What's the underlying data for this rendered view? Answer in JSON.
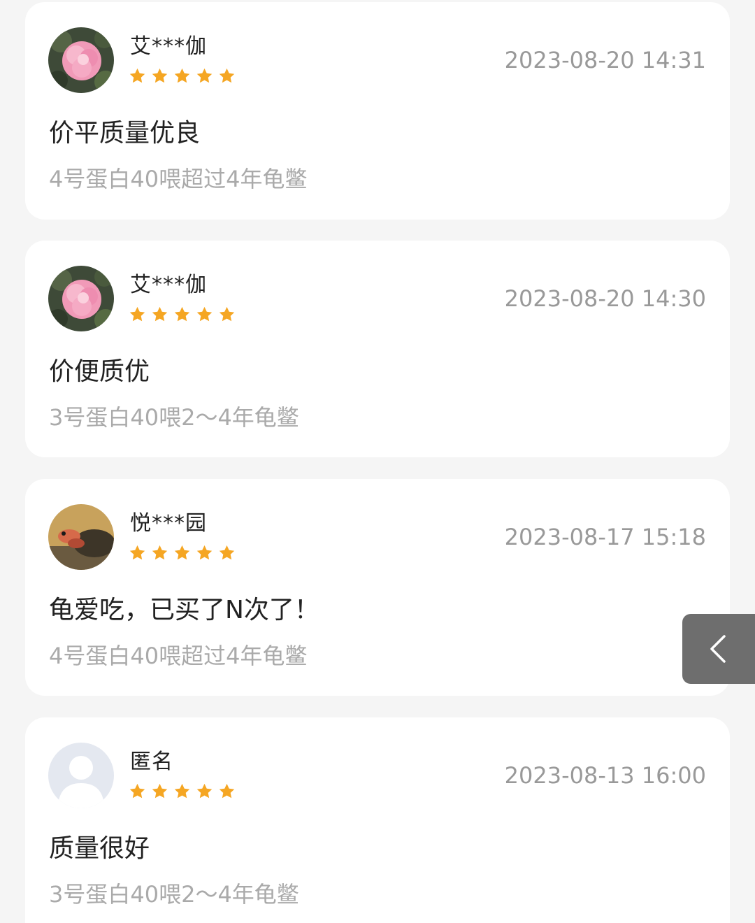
{
  "reviews": [
    {
      "username": "艾***伽",
      "avatar": "pink-flower-avatar",
      "rating": 5,
      "timestamp": "2023-08-20 14:31",
      "text": "价平质量优良",
      "variant": "4号蛋白40喂超过4年龟鳖"
    },
    {
      "username": "艾***伽",
      "avatar": "pink-flower-avatar",
      "rating": 5,
      "timestamp": "2023-08-20 14:30",
      "text": "价便质优",
      "variant": "3号蛋白40喂2～4年龟鳖"
    },
    {
      "username": "悦***园",
      "avatar": "turtle-avatar",
      "rating": 5,
      "timestamp": "2023-08-17 15:18",
      "text": "龟爱吃，已买了N次了！",
      "variant": "4号蛋白40喂超过4年龟鳖"
    },
    {
      "username": "匿名",
      "avatar": "default-user-avatar",
      "rating": 5,
      "timestamp": "2023-08-13 16:00",
      "text": "质量很好",
      "variant": "3号蛋白40喂2～4年龟鳖"
    }
  ],
  "side_button": {
    "icon": "chevron-left-icon"
  },
  "colors": {
    "background": "#f5f5f5",
    "card": "#ffffff",
    "star": "#f5a623",
    "primary_text": "#222222",
    "secondary_text": "#999999",
    "side_button": "#6e6e6e"
  }
}
